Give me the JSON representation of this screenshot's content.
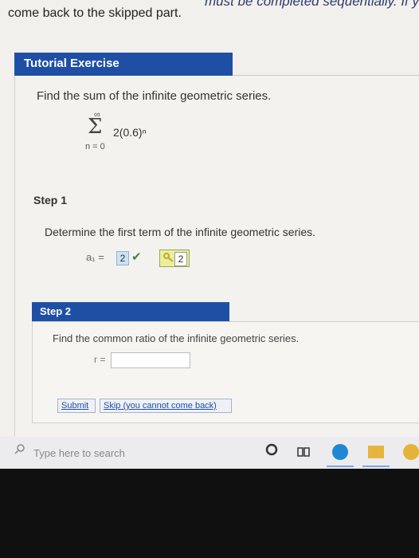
{
  "top": {
    "cut_text": "must be completed sequentially. If y",
    "text": "come back to the skipped part."
  },
  "tutorial": {
    "title": "Tutorial Exercise",
    "question": "Find the sum of the infinite geometric series.",
    "series": {
      "upper": "∞",
      "symbol": "Σ",
      "expression": "2(0.6)ⁿ",
      "lower": "n = 0"
    }
  },
  "step1": {
    "label": "Step 1",
    "text": "Determine the first term of the infinite geometric series.",
    "a1_label": "a₁ =",
    "a1_value": "2",
    "check": "✔",
    "hint_value": "2"
  },
  "step2": {
    "label": "Step 2",
    "text": "Find the common ratio of the infinite geometric series.",
    "r_label": "r =",
    "r_value": "",
    "submit_label": "Submit",
    "skip_label": "Skip (you cannot come back)"
  },
  "taskbar": {
    "search_placeholder": "Type here to search",
    "icons": [
      "search-icon",
      "cortana-icon",
      "task-view-icon",
      "edge-icon",
      "file-explorer-icon",
      "chrome-icon"
    ]
  },
  "colors": {
    "header_blue": "#1f4fa5",
    "check_green": "#3d8a3b",
    "hint_yellow": "#e9ef9a"
  }
}
